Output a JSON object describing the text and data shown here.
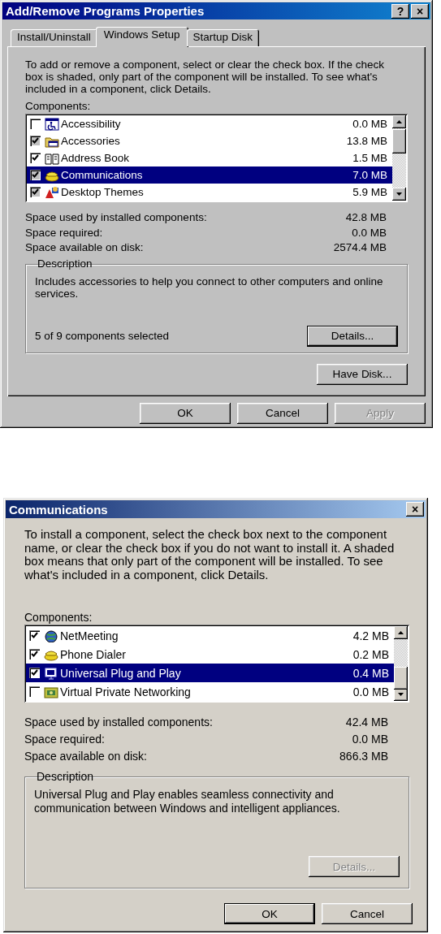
{
  "dialogs": [
    {
      "title": "Add/Remove Programs Properties",
      "help_button": "?",
      "close_button": "×",
      "tabs": [
        {
          "label": "Install/Uninstall",
          "selected": false
        },
        {
          "label": "Windows Setup",
          "selected": true
        },
        {
          "label": "Startup Disk",
          "selected": false
        }
      ],
      "intro": "To add or remove a component, select or clear the check box. If the check box is shaded, only part of the component will be installed. To see what's included in a component, click Details.",
      "components_label": "Components:",
      "components": [
        {
          "name": "Accessibility",
          "size": "0.0 MB",
          "checked": false,
          "partial": false,
          "selected": false
        },
        {
          "name": "Accessories",
          "size": "13.8 MB",
          "checked": true,
          "partial": true,
          "selected": false
        },
        {
          "name": "Address Book",
          "size": "1.5 MB",
          "checked": true,
          "partial": false,
          "selected": false
        },
        {
          "name": "Communications",
          "size": "7.0 MB",
          "checked": true,
          "partial": true,
          "selected": true
        },
        {
          "name": "Desktop Themes",
          "size": "5.9 MB",
          "checked": true,
          "partial": true,
          "selected": false
        }
      ],
      "stats": [
        {
          "label": "Space used by installed components:",
          "value": "42.8 MB"
        },
        {
          "label": "Space required:",
          "value": "0.0 MB"
        },
        {
          "label": "Space available on disk:",
          "value": "2574.4 MB"
        }
      ],
      "description": {
        "legend": "Description",
        "text": "Includes accessories to help you connect to other computers and online services.",
        "count": "5 of 9 components selected",
        "details": {
          "label": "Details...",
          "disabled": false,
          "default": true
        }
      },
      "have_disk": {
        "label": "Have Disk...",
        "disabled": false,
        "default": false
      },
      "buttons": [
        {
          "label": "OK",
          "disabled": false,
          "default": false
        },
        {
          "label": "Cancel",
          "disabled": false,
          "default": false
        },
        {
          "label": "Apply",
          "disabled": true,
          "default": false
        }
      ]
    },
    {
      "title": "Communications",
      "close_button": "×",
      "intro": "To install a component, select the check box next to the component name, or clear the check box if you do not want to install it. A shaded box means that only part of the component will be installed. To see what's included in a component, click Details.",
      "components_label": "Components:",
      "components": [
        {
          "name": "NetMeeting",
          "size": "4.2 MB",
          "checked": true,
          "partial": false,
          "selected": false
        },
        {
          "name": "Phone Dialer",
          "size": "0.2 MB",
          "checked": true,
          "partial": false,
          "selected": false
        },
        {
          "name": "Universal Plug and Play",
          "size": "0.4 MB",
          "checked": true,
          "partial": false,
          "selected": true
        },
        {
          "name": "Virtual Private Networking",
          "size": "0.0 MB",
          "checked": false,
          "partial": false,
          "selected": false
        }
      ],
      "stats": [
        {
          "label": "Space used by installed components:",
          "value": "42.4 MB"
        },
        {
          "label": "Space required:",
          "value": "0.0 MB"
        },
        {
          "label": "Space available on disk:",
          "value": "866.3 MB"
        }
      ],
      "description": {
        "legend": "Description",
        "text": "Universal Plug and Play enables seamless connectivity and communication between Windows and intelligent appliances.",
        "details": {
          "label": "Details...",
          "disabled": true,
          "default": false
        }
      },
      "buttons": [
        {
          "label": "OK",
          "disabled": false,
          "default": true
        },
        {
          "label": "Cancel",
          "disabled": false,
          "default": false
        }
      ]
    }
  ]
}
